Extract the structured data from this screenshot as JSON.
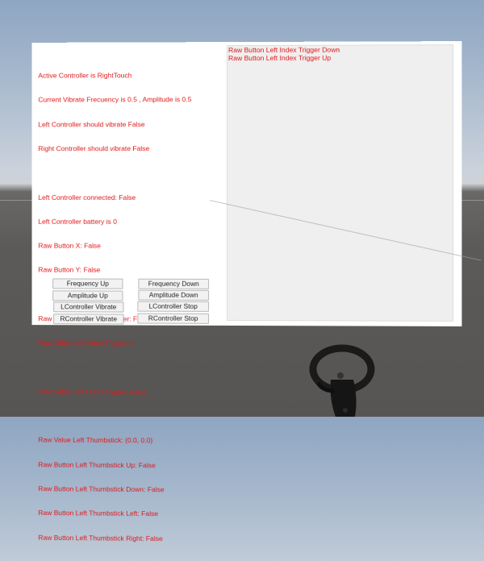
{
  "status": {
    "lines": [
      "Active Controller is RightTouch",
      "Current Vibrate Frecuency is 0.5 , Amplitude is 0.5",
      "Left Controller should vibrate False",
      "Right Controller should vibrate False",
      "",
      "Left Controller connected: False",
      "Left Controller battery is 0",
      "Raw Button X: False",
      "Raw Button Y: False",
      "",
      "Raw Button Left Index Trigger: False",
      "Raw Value Left Index Trigger: 0",
      "",
      "Raw Value Left Hand Trigger: False",
      "",
      "Raw Value Left Thumbstick: (0.0, 0.0)",
      "Raw Button Left Thumbstick Up: False",
      "Raw Button Left Thumbstick Down: False",
      "Raw Button Left Thumbstick Left: False",
      "Raw Button Left Thumbstick Right: False"
    ]
  },
  "log": {
    "lines": [
      "Raw Button Left Index Trigger Down",
      "Raw Button Left Index Trigger Up"
    ]
  },
  "buttons": {
    "frequency_up": "Frequency Up",
    "frequency_down": "Frequency Down",
    "amplitude_up": "Amplitude Up",
    "amplitude_down": "Amplitude Down",
    "lcontroller_vibrate": "LController Vibrate",
    "lcontroller_stop": "LController Stop",
    "rcontroller_vibrate": "RController Vibrate",
    "rcontroller_stop": "RController Stop"
  },
  "colors": {
    "status_text": "#e0181a",
    "panel": "#ffffff",
    "log_background": "#efefef"
  },
  "icons": {
    "controller": "vr-touch-controller-icon"
  }
}
